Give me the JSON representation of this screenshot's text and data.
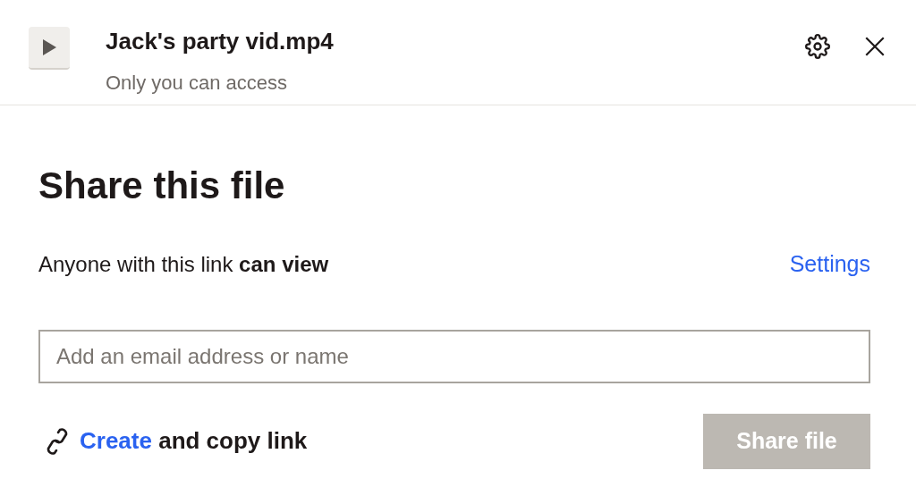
{
  "file": {
    "title": "Jack's party vid.mp4",
    "subtitle": "Only you can access"
  },
  "heading": "Share this file",
  "access": {
    "text": "Anyone with this link **can view**",
    "settings_link": "Settings"
  },
  "invite": {
    "placeholder": "Add an email address or name"
  },
  "copy_link": {
    "link": "Create",
    "rest": "and copy link"
  },
  "share_button": {
    "label": "Share file",
    "disabled": true
  }
}
